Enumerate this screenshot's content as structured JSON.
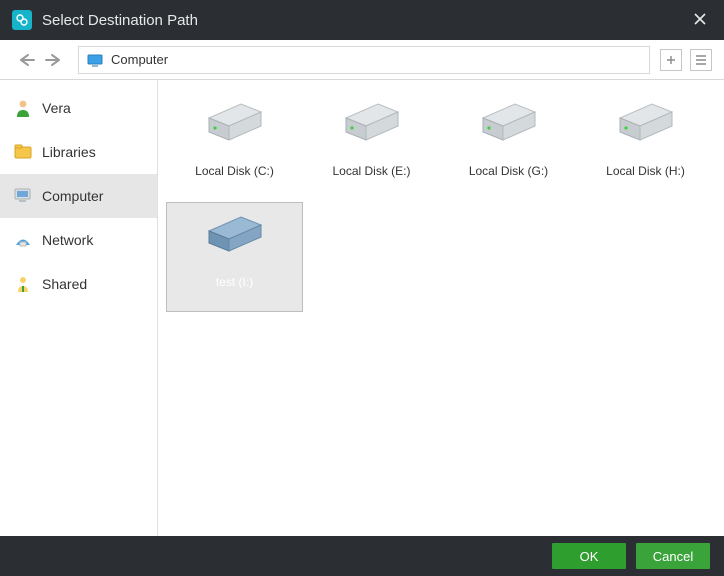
{
  "titlebar": {
    "title": "Select Destination Path"
  },
  "toolbar": {
    "path_label": "Computer"
  },
  "sidebar": {
    "items": [
      {
        "label": "Vera",
        "icon": "user-icon"
      },
      {
        "label": "Libraries",
        "icon": "libraries-icon"
      },
      {
        "label": "Computer",
        "icon": "computer-icon",
        "selected": true
      },
      {
        "label": "Network",
        "icon": "network-icon"
      },
      {
        "label": "Shared",
        "icon": "shared-icon"
      }
    ]
  },
  "drives": [
    {
      "label": "Local Disk (C:)",
      "kind": "hdd"
    },
    {
      "label": "Local Disk (E:)",
      "kind": "hdd"
    },
    {
      "label": "Local Disk (G:)",
      "kind": "hdd"
    },
    {
      "label": "Local Disk (H:)",
      "kind": "hdd"
    },
    {
      "label": "test (I:)",
      "kind": "removable",
      "selected": true
    }
  ],
  "footer": {
    "ok": "OK",
    "cancel": "Cancel"
  }
}
